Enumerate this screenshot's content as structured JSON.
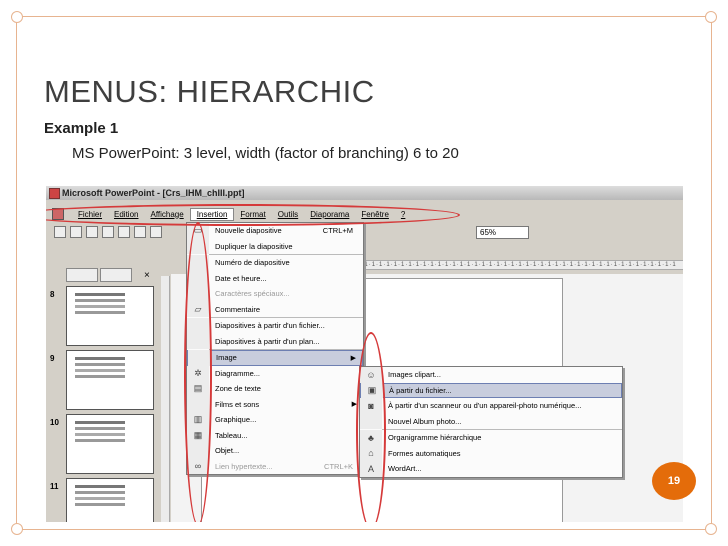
{
  "slide": {
    "title": "MENUS: HIERARCHIC",
    "subtitle": "Example 1",
    "body": "MS PowerPoint: 3 level, width (factor of branching) 6 to 20",
    "page_number": "19"
  },
  "app": {
    "window_title": "Microsoft PowerPoint - [Crs_IHM_chIII.ppt]",
    "menubar": [
      "Fichier",
      "Edition",
      "Affichage",
      "Insertion",
      "Format",
      "Outils",
      "Diaporama",
      "Fenêtre",
      "?"
    ],
    "zoom": "65%",
    "thumb_numbers": [
      "8",
      "9",
      "10",
      "11"
    ],
    "insertion_menu": [
      {
        "label": "Nouvelle diapositive",
        "shortcut": "CTRL+M",
        "icon": "new-slide-icon"
      },
      {
        "label": "Dupliquer la diapositive",
        "shortcut": ""
      },
      {
        "label": "Numéro de diapositive",
        "shortcut": ""
      },
      {
        "label": "Date et heure...",
        "shortcut": ""
      },
      {
        "label": "Caractères spéciaux...",
        "shortcut": "",
        "disabled": true
      },
      {
        "label": "Commentaire",
        "shortcut": "",
        "icon": "comment-icon"
      },
      {
        "label": "Diapositives à partir d'un fichier...",
        "shortcut": ""
      },
      {
        "label": "Diapositives à partir d'un plan...",
        "shortcut": ""
      },
      {
        "label": "Image",
        "shortcut": "",
        "submenu": true,
        "highlight": true
      },
      {
        "label": "Diagramme...",
        "shortcut": "",
        "icon": "diagram-icon"
      },
      {
        "label": "Zone de texte",
        "shortcut": "",
        "icon": "textbox-icon"
      },
      {
        "label": "Films et sons",
        "shortcut": "",
        "submenu": true
      },
      {
        "label": "Graphique...",
        "shortcut": "",
        "icon": "chart-icon"
      },
      {
        "label": "Tableau...",
        "shortcut": "",
        "icon": "table-icon"
      },
      {
        "label": "Objet...",
        "shortcut": ""
      },
      {
        "label": "Lien hypertexte...",
        "shortcut": "CTRL+K",
        "disabled": true
      }
    ],
    "image_submenu": [
      {
        "label": "Images clipart...",
        "icon": "clipart-icon"
      },
      {
        "label": "À partir du fichier...",
        "icon": "picture-file-icon",
        "highlight": true
      },
      {
        "label": "À partir d'un scanneur ou d'un appareil-photo numérique...",
        "icon": "scanner-icon"
      },
      {
        "label": "Nouvel Album photo...",
        "icon": ""
      },
      {
        "label": "Organigramme hiérarchique",
        "icon": "org-chart-icon"
      },
      {
        "label": "Formes automatiques",
        "icon": "autoshapes-icon"
      },
      {
        "label": "WordArt...",
        "icon": "wordart-icon"
      }
    ]
  }
}
